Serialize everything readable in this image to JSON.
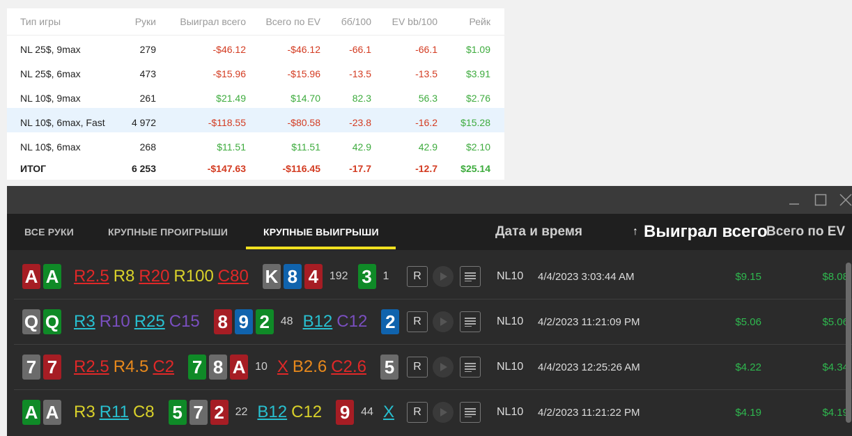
{
  "stats": {
    "headers": [
      "Тип игры",
      "Руки",
      "Выиграл всего",
      "Всего по EV",
      "бб/100",
      "EV bb/100",
      "Рейк"
    ],
    "rows": [
      [
        "NL 25$, 9max",
        "279",
        "-$46.12",
        "-$46.12",
        "-66.1",
        "-66.1",
        "$1.09"
      ],
      [
        "NL 25$, 6max",
        "473",
        "-$15.96",
        "-$15.96",
        "-13.5",
        "-13.5",
        "$3.91"
      ],
      [
        "NL 10$, 9max",
        "261",
        "$21.49",
        "$14.70",
        "82.3",
        "56.3",
        "$2.76"
      ],
      [
        "NL 10$, 6max, Fast",
        "4 972",
        "-$118.55",
        "-$80.58",
        "-23.8",
        "-16.2",
        "$15.28"
      ],
      [
        "NL 10$, 6max",
        "268",
        "$11.51",
        "$11.51",
        "42.9",
        "42.9",
        "$2.10"
      ]
    ],
    "total": [
      "ИТОГ",
      "6 253",
      "-$147.63",
      "-$116.45",
      "-17.7",
      "-12.7",
      "$25.14"
    ]
  },
  "window": {
    "tabs": [
      "ВСЕ РУКИ",
      "КРУПНЫЕ ПРОИГРЫШИ",
      "КРУПНЫЕ ВЫИГРЫШИ"
    ],
    "columns": {
      "date": "Дата и время",
      "sort_arrow": "↑",
      "won": "Выиграл всего",
      "ev": "Всего по EV"
    },
    "replay_label": "R",
    "colors": {
      "red": "#a61d24",
      "green": "#0f8a27",
      "blue": "#1063ad",
      "gray": "#6b6b6b",
      "accent": "#f0e020",
      "money": "#2fb84f"
    },
    "hands": [
      {
        "stake": "NL10",
        "date": "4/4/2023 3:03:44 AM",
        "won": "$9.15",
        "ev": "$8.08"
      },
      {
        "stake": "NL10",
        "date": "4/2/2023 11:21:09 PM",
        "won": "$5.06",
        "ev": "$5.06"
      },
      {
        "stake": "NL10",
        "date": "4/4/2023 12:25:26 AM",
        "won": "$4.22",
        "ev": "$4.34"
      },
      {
        "stake": "NL10",
        "date": "4/2/2023 11:21:22 PM",
        "won": "$4.19",
        "ev": "$4.19"
      }
    ],
    "lines": [
      {
        "hole": [
          {
            "r": "A",
            "c": "red"
          },
          {
            "r": "A",
            "c": "green"
          }
        ],
        "preflop": [
          {
            "t": "R2.5",
            "col": "#e02828",
            "u": true
          },
          {
            "t": "R8",
            "col": "#d9d12a",
            "u": false
          },
          {
            "t": "R20",
            "col": "#e02828",
            "u": true
          },
          {
            "t": "R100",
            "col": "#d9d12a",
            "u": false
          },
          {
            "t": "C80",
            "col": "#e02828",
            "u": true
          }
        ],
        "flop": {
          "cards": [
            {
              "r": "K",
              "c": "gray"
            },
            {
              "r": "8",
              "c": "blue"
            },
            {
              "r": "4",
              "c": "red"
            }
          ],
          "pot": "192",
          "actions": []
        },
        "turn": {
          "cards": [
            {
              "r": "3",
              "c": "green"
            }
          ],
          "pot": "1",
          "actions": []
        }
      },
      {
        "hole": [
          {
            "r": "Q",
            "c": "gray"
          },
          {
            "r": "Q",
            "c": "green"
          }
        ],
        "preflop": [
          {
            "t": "R3",
            "col": "#28c0d0",
            "u": true
          },
          {
            "t": "R10",
            "col": "#7a4fc0",
            "u": false
          },
          {
            "t": "R25",
            "col": "#28c0d0",
            "u": true
          },
          {
            "t": "C15",
            "col": "#7a4fc0",
            "u": false
          }
        ],
        "flop": {
          "cards": [
            {
              "r": "8",
              "c": "red"
            },
            {
              "r": "9",
              "c": "blue"
            },
            {
              "r": "2",
              "c": "green"
            }
          ],
          "pot": "48",
          "actions": [
            {
              "t": "B12",
              "col": "#28c0d0",
              "u": true
            },
            {
              "t": "C12",
              "col": "#7a4fc0",
              "u": false
            }
          ]
        },
        "turn": {
          "cards": [
            {
              "r": "2",
              "c": "blue"
            }
          ],
          "pot": "",
          "actions": []
        }
      },
      {
        "hole": [
          {
            "r": "7",
            "c": "gray"
          },
          {
            "r": "7",
            "c": "red"
          }
        ],
        "preflop": [
          {
            "t": "R2.5",
            "col": "#e02828",
            "u": true
          },
          {
            "t": "R4.5",
            "col": "#e8891c",
            "u": false
          },
          {
            "t": "C2",
            "col": "#e02828",
            "u": true
          }
        ],
        "flop": {
          "cards": [
            {
              "r": "7",
              "c": "green"
            },
            {
              "r": "8",
              "c": "gray"
            },
            {
              "r": "A",
              "c": "red"
            }
          ],
          "pot": "10",
          "actions": [
            {
              "t": "X",
              "col": "#e02828",
              "u": true
            },
            {
              "t": "B2.6",
              "col": "#e8891c",
              "u": false
            },
            {
              "t": "C2.6",
              "col": "#e02828",
              "u": true
            }
          ]
        },
        "turn": {
          "cards": [
            {
              "r": "5",
              "c": "gray"
            }
          ],
          "pot": "",
          "actions": []
        }
      },
      {
        "hole": [
          {
            "r": "A",
            "c": "green"
          },
          {
            "r": "A",
            "c": "gray"
          }
        ],
        "preflop": [
          {
            "t": "R3",
            "col": "#d9d12a",
            "u": false
          },
          {
            "t": "R11",
            "col": "#28c0d0",
            "u": true
          },
          {
            "t": "C8",
            "col": "#d9d12a",
            "u": false
          }
        ],
        "flop": {
          "cards": [
            {
              "r": "5",
              "c": "green"
            },
            {
              "r": "7",
              "c": "gray"
            },
            {
              "r": "2",
              "c": "red"
            }
          ],
          "pot": "22",
          "actions": [
            {
              "t": "B12",
              "col": "#28c0d0",
              "u": true
            },
            {
              "t": "C12",
              "col": "#d9d12a",
              "u": false
            }
          ]
        },
        "turn": {
          "cards": [
            {
              "r": "9",
              "c": "red"
            }
          ],
          "pot": "44",
          "actions": [
            {
              "t": "X",
              "col": "#28c0d0",
              "u": true
            }
          ]
        }
      }
    ]
  }
}
